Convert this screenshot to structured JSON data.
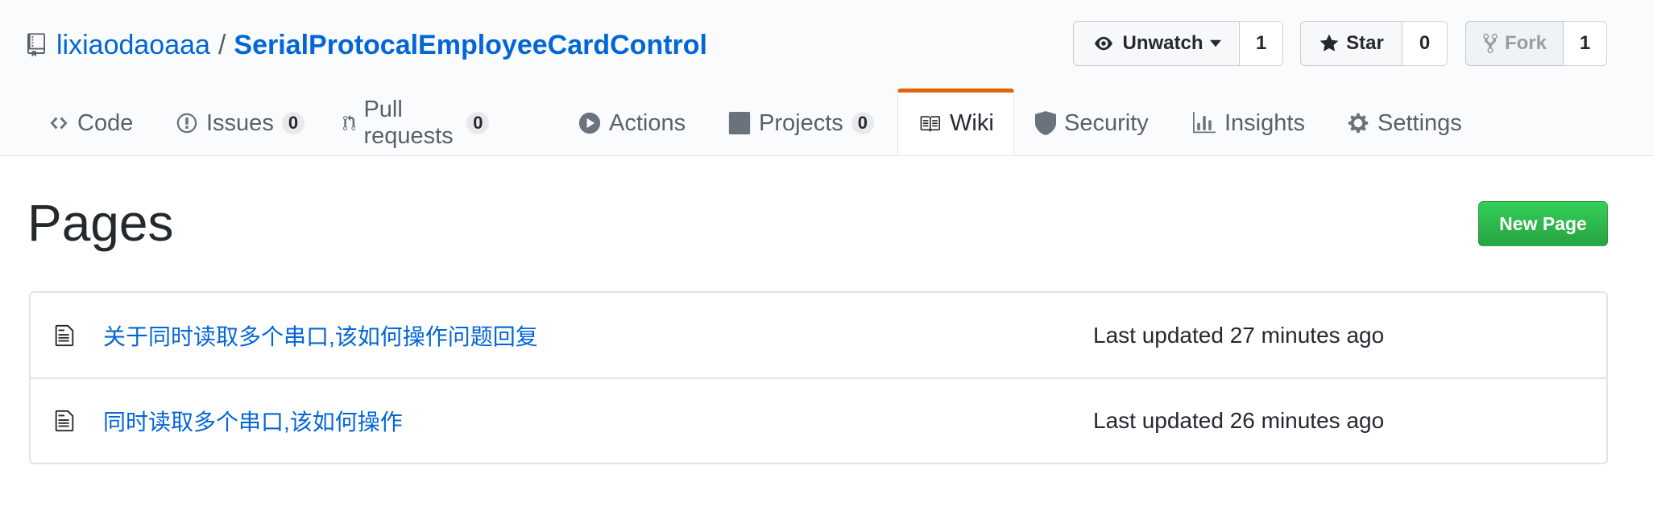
{
  "repo": {
    "owner": "lixiaodaoaaa",
    "separator": "/",
    "name": "SerialProtocalEmployeeCardControl"
  },
  "actions": {
    "watch": {
      "label": "Unwatch",
      "count": "1"
    },
    "star": {
      "label": "Star",
      "count": "0"
    },
    "fork": {
      "label": "Fork",
      "count": "1"
    }
  },
  "tabs": [
    {
      "label": "Code",
      "icon": "code-icon"
    },
    {
      "label": "Issues",
      "icon": "issue-icon",
      "counter": "0"
    },
    {
      "label": "Pull requests",
      "icon": "git-pull-request-icon",
      "counter": "0"
    },
    {
      "label": "Actions",
      "icon": "play-icon"
    },
    {
      "label": "Projects",
      "icon": "project-icon",
      "counter": "0"
    },
    {
      "label": "Wiki",
      "icon": "book-icon",
      "selected": true
    },
    {
      "label": "Security",
      "icon": "shield-icon"
    },
    {
      "label": "Insights",
      "icon": "graph-icon"
    },
    {
      "label": "Settings",
      "icon": "gear-icon"
    }
  ],
  "main": {
    "title": "Pages",
    "new_page_label": "New Page",
    "pages": [
      {
        "title": "关于同时读取多个串口,该如何操作问题回复",
        "updated": "Last updated 27 minutes ago"
      },
      {
        "title": "同时读取多个串口,该如何操作",
        "updated": "Last updated 26 minutes ago"
      }
    ]
  },
  "colors": {
    "link": "#0366d6",
    "selected_tab_accent": "#e36209",
    "primary_button": "#2ea44f"
  }
}
